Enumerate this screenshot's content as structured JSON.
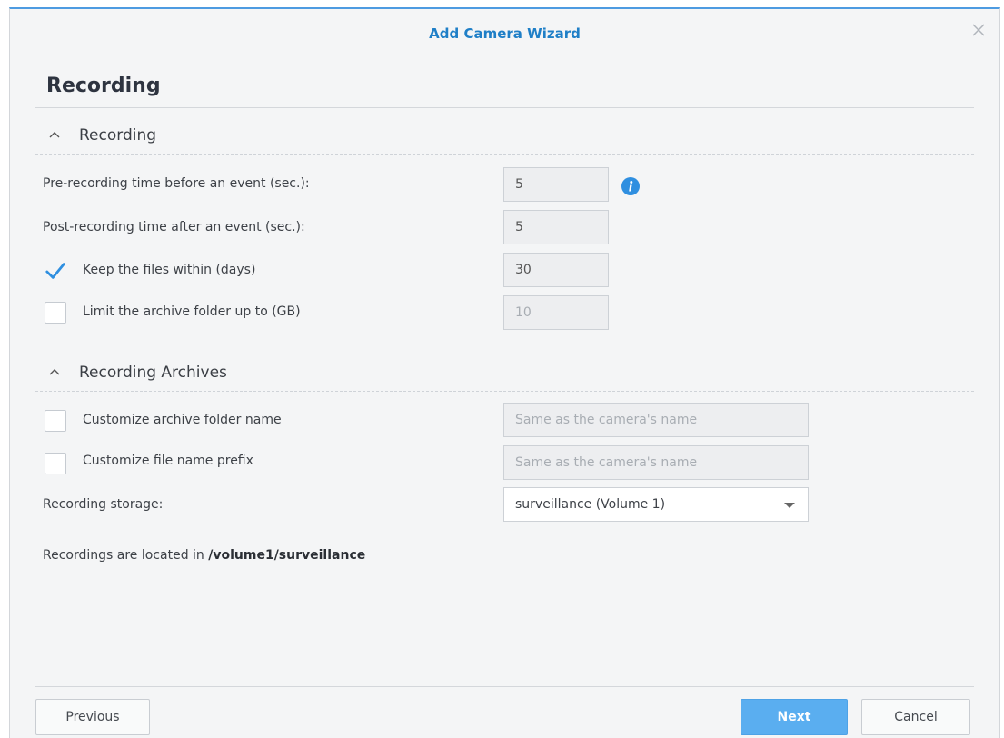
{
  "window": {
    "title": "Add Camera Wizard"
  },
  "page": {
    "title": "Recording"
  },
  "sections": {
    "recording": {
      "label": "Recording"
    },
    "archives": {
      "label": "Recording Archives"
    }
  },
  "fields": {
    "pre_recording": {
      "label": "Pre-recording time before an event (sec.):",
      "value": "5"
    },
    "post_recording": {
      "label": "Post-recording time after an event (sec.):",
      "value": "5"
    },
    "keep_files": {
      "label": "Keep the files within (days)",
      "value": "30",
      "checked": true
    },
    "limit_archive": {
      "label": "Limit the archive folder up to (GB)",
      "value": "10",
      "checked": false
    },
    "custom_folder": {
      "label": "Customize archive folder name",
      "placeholder": "Same as the camera's name",
      "checked": false
    },
    "custom_prefix": {
      "label": "Customize file name prefix",
      "placeholder": "Same as the camera's name",
      "checked": false
    },
    "storage": {
      "label": "Recording storage:",
      "value": "surveillance (Volume 1)"
    }
  },
  "note": {
    "prefix": "Recordings are located in",
    "path": "/volume1/surveillance"
  },
  "buttons": {
    "previous": "Previous",
    "next": "Next",
    "cancel": "Cancel"
  },
  "colors": {
    "accent": "#1f7fc7",
    "primary_button": "#5aaef0",
    "check": "#2f8fe0"
  },
  "icons": {
    "close": "close-icon",
    "collapse": "chevron-up-icon",
    "info": "info-icon",
    "dropdown": "caret-down-icon",
    "check": "checkmark-icon"
  }
}
